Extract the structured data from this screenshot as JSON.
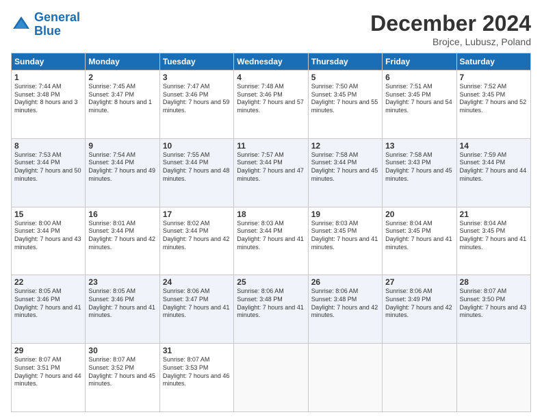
{
  "logo": {
    "line1": "General",
    "line2": "Blue"
  },
  "header": {
    "title": "December 2024",
    "subtitle": "Brojce, Lubusz, Poland"
  },
  "weekdays": [
    "Sunday",
    "Monday",
    "Tuesday",
    "Wednesday",
    "Thursday",
    "Friday",
    "Saturday"
  ],
  "weeks": [
    [
      {
        "day": "1",
        "sunrise": "7:44 AM",
        "sunset": "3:48 PM",
        "daylight": "8 hours and 3 minutes."
      },
      {
        "day": "2",
        "sunrise": "7:45 AM",
        "sunset": "3:47 PM",
        "daylight": "8 hours and 1 minute."
      },
      {
        "day": "3",
        "sunrise": "7:47 AM",
        "sunset": "3:46 PM",
        "daylight": "7 hours and 59 minutes."
      },
      {
        "day": "4",
        "sunrise": "7:48 AM",
        "sunset": "3:46 PM",
        "daylight": "7 hours and 57 minutes."
      },
      {
        "day": "5",
        "sunrise": "7:50 AM",
        "sunset": "3:45 PM",
        "daylight": "7 hours and 55 minutes."
      },
      {
        "day": "6",
        "sunrise": "7:51 AM",
        "sunset": "3:45 PM",
        "daylight": "7 hours and 54 minutes."
      },
      {
        "day": "7",
        "sunrise": "7:52 AM",
        "sunset": "3:45 PM",
        "daylight": "7 hours and 52 minutes."
      }
    ],
    [
      {
        "day": "8",
        "sunrise": "7:53 AM",
        "sunset": "3:44 PM",
        "daylight": "7 hours and 50 minutes."
      },
      {
        "day": "9",
        "sunrise": "7:54 AM",
        "sunset": "3:44 PM",
        "daylight": "7 hours and 49 minutes."
      },
      {
        "day": "10",
        "sunrise": "7:55 AM",
        "sunset": "3:44 PM",
        "daylight": "7 hours and 48 minutes."
      },
      {
        "day": "11",
        "sunrise": "7:57 AM",
        "sunset": "3:44 PM",
        "daylight": "7 hours and 47 minutes."
      },
      {
        "day": "12",
        "sunrise": "7:58 AM",
        "sunset": "3:44 PM",
        "daylight": "7 hours and 45 minutes."
      },
      {
        "day": "13",
        "sunrise": "7:58 AM",
        "sunset": "3:43 PM",
        "daylight": "7 hours and 45 minutes."
      },
      {
        "day": "14",
        "sunrise": "7:59 AM",
        "sunset": "3:44 PM",
        "daylight": "7 hours and 44 minutes."
      }
    ],
    [
      {
        "day": "15",
        "sunrise": "8:00 AM",
        "sunset": "3:44 PM",
        "daylight": "7 hours and 43 minutes."
      },
      {
        "day": "16",
        "sunrise": "8:01 AM",
        "sunset": "3:44 PM",
        "daylight": "7 hours and 42 minutes."
      },
      {
        "day": "17",
        "sunrise": "8:02 AM",
        "sunset": "3:44 PM",
        "daylight": "7 hours and 42 minutes."
      },
      {
        "day": "18",
        "sunrise": "8:03 AM",
        "sunset": "3:44 PM",
        "daylight": "7 hours and 41 minutes."
      },
      {
        "day": "19",
        "sunrise": "8:03 AM",
        "sunset": "3:45 PM",
        "daylight": "7 hours and 41 minutes."
      },
      {
        "day": "20",
        "sunrise": "8:04 AM",
        "sunset": "3:45 PM",
        "daylight": "7 hours and 41 minutes."
      },
      {
        "day": "21",
        "sunrise": "8:04 AM",
        "sunset": "3:45 PM",
        "daylight": "7 hours and 41 minutes."
      }
    ],
    [
      {
        "day": "22",
        "sunrise": "8:05 AM",
        "sunset": "3:46 PM",
        "daylight": "7 hours and 41 minutes."
      },
      {
        "day": "23",
        "sunrise": "8:05 AM",
        "sunset": "3:46 PM",
        "daylight": "7 hours and 41 minutes."
      },
      {
        "day": "24",
        "sunrise": "8:06 AM",
        "sunset": "3:47 PM",
        "daylight": "7 hours and 41 minutes."
      },
      {
        "day": "25",
        "sunrise": "8:06 AM",
        "sunset": "3:48 PM",
        "daylight": "7 hours and 41 minutes."
      },
      {
        "day": "26",
        "sunrise": "8:06 AM",
        "sunset": "3:48 PM",
        "daylight": "7 hours and 42 minutes."
      },
      {
        "day": "27",
        "sunrise": "8:06 AM",
        "sunset": "3:49 PM",
        "daylight": "7 hours and 42 minutes."
      },
      {
        "day": "28",
        "sunrise": "8:07 AM",
        "sunset": "3:50 PM",
        "daylight": "7 hours and 43 minutes."
      }
    ],
    [
      {
        "day": "29",
        "sunrise": "8:07 AM",
        "sunset": "3:51 PM",
        "daylight": "7 hours and 44 minutes."
      },
      {
        "day": "30",
        "sunrise": "8:07 AM",
        "sunset": "3:52 PM",
        "daylight": "7 hours and 45 minutes."
      },
      {
        "day": "31",
        "sunrise": "8:07 AM",
        "sunset": "3:53 PM",
        "daylight": "7 hours and 46 minutes."
      },
      null,
      null,
      null,
      null
    ]
  ]
}
